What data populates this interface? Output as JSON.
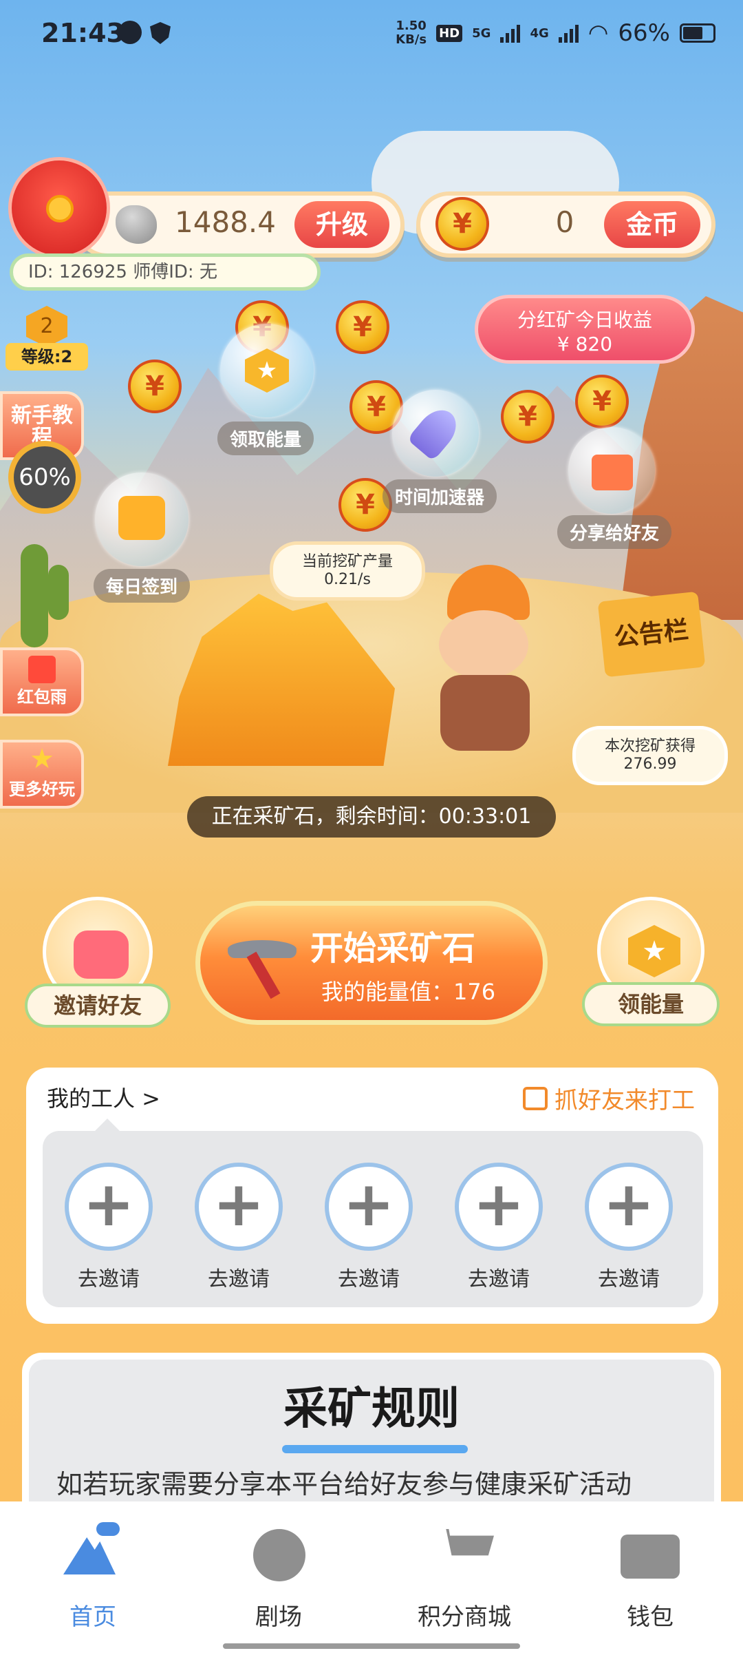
{
  "status": {
    "time": "21:43",
    "net_speed": "1.50\nKB/s",
    "net_speed_top": "1.50",
    "net_speed_bottom": "KB/s",
    "hd": "HD",
    "sim1": "5G",
    "sim2": "4G",
    "battery": "66%"
  },
  "header": {
    "ore_amount": "1488.4",
    "upgrade_label": "升级",
    "coin_amount": "0",
    "coin_label": "金币",
    "user_ids": "ID: 126925  师傅ID: 无"
  },
  "dividend": {
    "title": "分红矿今日收益",
    "amount": "¥ 820"
  },
  "level": {
    "number": "2",
    "label": "等级:2"
  },
  "side": {
    "tutorial_label": "新手教程",
    "progress": "60%",
    "red_packet_label": "红包雨",
    "more_fun_label": "更多好玩"
  },
  "scene": {
    "claim_energy": "领取能量",
    "time_accelerator": "时间加速器",
    "share_friends": "分享给好友",
    "daily_checkin": "每日签到",
    "notice_board": "公告栏",
    "rate_title": "当前挖矿产量",
    "rate_value": "0.21/s",
    "gain_title": "本次挖矿获得",
    "gain_value": "276.99",
    "mining_status": "正在采矿石，剩余时间：00:33:01",
    "coin_symbol": "¥"
  },
  "actions": {
    "invite_friends": "邀请好友",
    "start_title": "开始采矿石",
    "energy_value": "我的能量值：176",
    "get_energy": "领能量"
  },
  "workers": {
    "title": "我的工人 >",
    "catch_friends": "抓好友来打工",
    "slots": [
      "去邀请",
      "去邀请",
      "去邀请",
      "去邀请",
      "去邀请"
    ]
  },
  "rules": {
    "title": "采矿规则",
    "text": "如若玩家需要分享本平台给好友参与健康采矿活动"
  },
  "tabs": [
    "首页",
    "剧场",
    "积分商城",
    "钱包"
  ],
  "colors": {
    "active_tab": "#4a8be0",
    "accent_red": "#e84646",
    "accent_orange": "#f28a2b"
  }
}
